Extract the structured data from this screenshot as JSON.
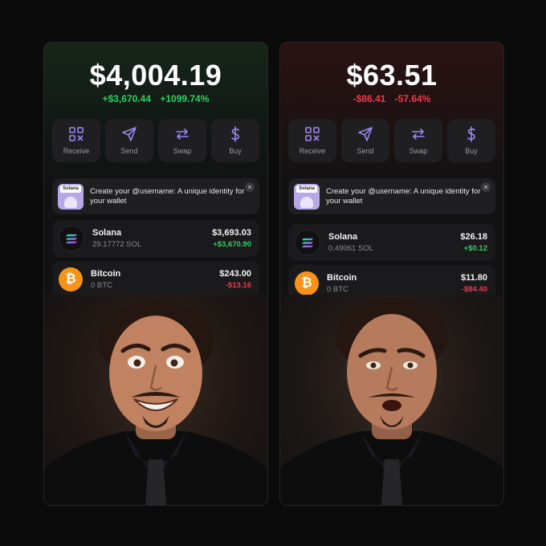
{
  "left": {
    "balance": "$4,004.19",
    "change_amount": "+$3,670.44",
    "change_percent": "+1099.74%",
    "actions": [
      {
        "label": "Receive",
        "icon": "qr-code-icon"
      },
      {
        "label": "Send",
        "icon": "send-icon"
      },
      {
        "label": "Swap",
        "icon": "swap-icon"
      },
      {
        "label": "Buy",
        "icon": "dollar-icon"
      }
    ],
    "promo": {
      "thumb_tag": "Solana",
      "text": "Create your @username: A unique identity for your wallet",
      "close": "×"
    },
    "assets": [
      {
        "name": "Solana",
        "amount": "29.17772 SOL",
        "value": "$3,693.03",
        "change": "+$3,670.90"
      },
      {
        "name": "Bitcoin",
        "amount": "0 BTC",
        "value": "$243.00",
        "change": "-$13.16"
      }
    ]
  },
  "right": {
    "balance": "$63.51",
    "change_amount": "-$86.41",
    "change_percent": "-57.64%",
    "actions": [
      {
        "label": "Receive",
        "icon": "qr-code-icon"
      },
      {
        "label": "Send",
        "icon": "send-icon"
      },
      {
        "label": "Swap",
        "icon": "swap-icon"
      },
      {
        "label": "Buy",
        "icon": "dollar-icon"
      }
    ],
    "promo": {
      "thumb_tag": "Solana",
      "text": "Create your @username: A unique identity for your wallet",
      "close": "×"
    },
    "assets": [
      {
        "name": "Solana",
        "amount": "0.49061 SOL",
        "value": "$26.18",
        "change": "+$0.12"
      },
      {
        "name": "Bitcoin",
        "amount": "0 BTC",
        "value": "$11.80",
        "change": "-$84.40"
      }
    ]
  },
  "colors": {
    "positive": "#2ed15f",
    "negative": "#f0394a",
    "accent": "#9a86f0",
    "bitcoin": "#f7931a"
  }
}
